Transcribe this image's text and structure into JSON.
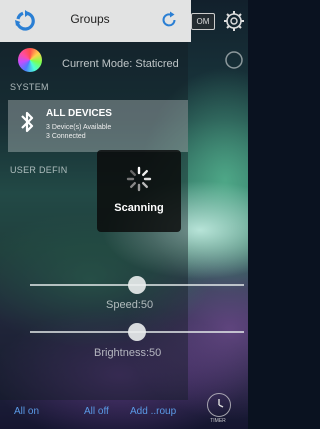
{
  "topbar": {
    "title": "Groups",
    "mode_button": "OM"
  },
  "mode": {
    "current_mode_text": "Current Mode: Staticred"
  },
  "sections": {
    "system_label": "SYSTEM",
    "user_defined_label": "USER DEFIN"
  },
  "device": {
    "title": "ALL DEVICES",
    "available_line": "3 Device(s) Available",
    "connected_line": "3 Connected"
  },
  "scanning": {
    "label": "Scanning"
  },
  "sliders": {
    "speed_caption": "Speed:50",
    "speed_value": 50,
    "brightness_caption": "Brightness:50",
    "brightness_value": 50
  },
  "bottom_bar": {
    "all_on": "All on",
    "all_off": "All off",
    "add_group": "Add ..roup",
    "timer": "TIMER"
  },
  "colors": {
    "accent_link": "#5a9ae6",
    "topbar_icon": "#2a7fd4"
  },
  "icons": [
    "refresh-groups-icon",
    "refresh-icon",
    "settings-gear-icon",
    "bluetooth-icon",
    "spinner-icon",
    "timer-icon",
    "color-wheel-icon"
  ]
}
